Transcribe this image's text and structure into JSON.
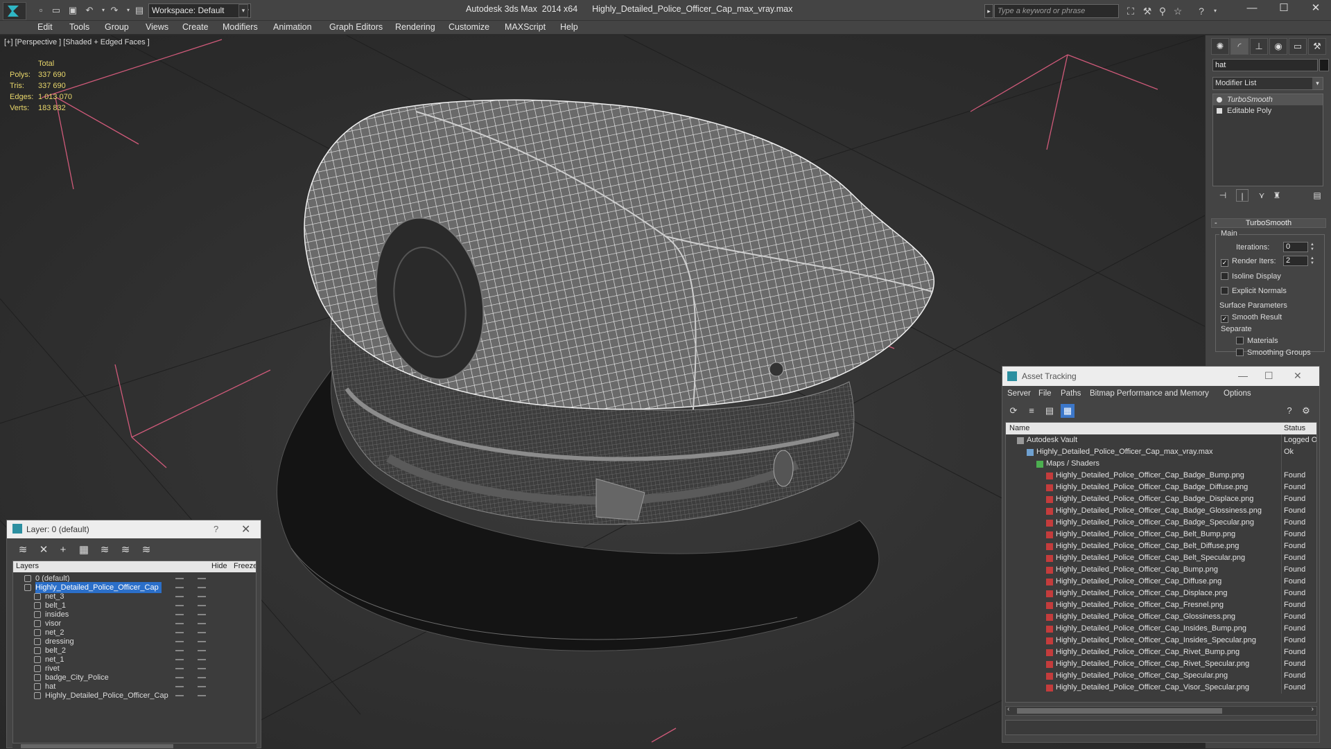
{
  "titlebar": {
    "workspace": "Workspace: Default",
    "app_title": "Autodesk 3ds Max  2014 x64",
    "file_title": "Highly_Detailed_Police_Officer_Cap_max_vray.max",
    "search_placeholder": "Type a keyword or phrase"
  },
  "menubar": [
    "Edit",
    "Tools",
    "Group",
    "Views",
    "Create",
    "Modifiers",
    "Animation",
    "Graph Editors",
    "Rendering",
    "Customize",
    "MAXScript",
    "Help"
  ],
  "viewport": {
    "label": "[+] [Perspective ] [Shaded + Edged Faces ]",
    "stats": {
      "header": "Total",
      "rows": [
        {
          "label": "Polys:",
          "value": "337 690"
        },
        {
          "label": "Tris:",
          "value": "337 690"
        },
        {
          "label": "Edges:",
          "value": "1 013 070"
        },
        {
          "label": "Verts:",
          "value": "183 832"
        }
      ]
    }
  },
  "command_panel": {
    "object_name": "hat",
    "modifier_list": "Modifier List",
    "stack": [
      "TurboSmooth",
      "Editable Poly"
    ],
    "rollout": "TurboSmooth",
    "main_group": "Main",
    "iterations_label": "Iterations:",
    "iterations_value": "0",
    "render_iters_label": "Render Iters:",
    "render_iters_value": "2",
    "isoline": "Isoline Display",
    "explicit_normals": "Explicit Normals",
    "surface_group": "Surface Parameters",
    "smooth_result": "Smooth Result",
    "separate": "Separate",
    "materials": "Materials",
    "smoothing_groups": "Smoothing Groups"
  },
  "layer_dialog": {
    "title": "Layer: 0 (default)",
    "help": "?",
    "columns": {
      "layers": "Layers",
      "hide": "Hide",
      "freeze": "Freeze"
    },
    "layers": [
      {
        "name": "0 (default)",
        "level": 0
      },
      {
        "name": "Highly_Detailed_Police_Officer_Cap",
        "level": 0,
        "selected": true
      },
      {
        "name": "net_3",
        "level": 1
      },
      {
        "name": "belt_1",
        "level": 1
      },
      {
        "name": "insides",
        "level": 1
      },
      {
        "name": "visor",
        "level": 1
      },
      {
        "name": "net_2",
        "level": 1
      },
      {
        "name": "dressing",
        "level": 1
      },
      {
        "name": "belt_2",
        "level": 1
      },
      {
        "name": "net_1",
        "level": 1
      },
      {
        "name": "rivet",
        "level": 1
      },
      {
        "name": "badge_City_Police",
        "level": 1
      },
      {
        "name": "hat",
        "level": 1
      },
      {
        "name": "Highly_Detailed_Police_Officer_Cap",
        "level": 1
      }
    ]
  },
  "asset_dialog": {
    "title": "Asset Tracking",
    "menu": [
      "Server",
      "File",
      "Paths",
      "Bitmap Performance and Memory",
      "Options"
    ],
    "columns": {
      "name": "Name",
      "status": "Status"
    },
    "rows": [
      {
        "name": "Autodesk Vault",
        "status": "Logged O",
        "level": 0
      },
      {
        "name": "Highly_Detailed_Police_Officer_Cap_max_vray.max",
        "status": "Ok",
        "level": 1
      },
      {
        "name": "Maps / Shaders",
        "status": "",
        "level": 2
      },
      {
        "name": "Highly_Detailed_Police_Officer_Cap_Badge_Bump.png",
        "status": "Found",
        "level": 3
      },
      {
        "name": "Highly_Detailed_Police_Officer_Cap_Badge_Diffuse.png",
        "status": "Found",
        "level": 3
      },
      {
        "name": "Highly_Detailed_Police_Officer_Cap_Badge_Displace.png",
        "status": "Found",
        "level": 3
      },
      {
        "name": "Highly_Detailed_Police_Officer_Cap_Badge_Glossiness.png",
        "status": "Found",
        "level": 3
      },
      {
        "name": "Highly_Detailed_Police_Officer_Cap_Badge_Specular.png",
        "status": "Found",
        "level": 3
      },
      {
        "name": "Highly_Detailed_Police_Officer_Cap_Belt_Bump.png",
        "status": "Found",
        "level": 3
      },
      {
        "name": "Highly_Detailed_Police_Officer_Cap_Belt_Diffuse.png",
        "status": "Found",
        "level": 3
      },
      {
        "name": "Highly_Detailed_Police_Officer_Cap_Belt_Specular.png",
        "status": "Found",
        "level": 3
      },
      {
        "name": "Highly_Detailed_Police_Officer_Cap_Bump.png",
        "status": "Found",
        "level": 3
      },
      {
        "name": "Highly_Detailed_Police_Officer_Cap_Diffuse.png",
        "status": "Found",
        "level": 3
      },
      {
        "name": "Highly_Detailed_Police_Officer_Cap_Displace.png",
        "status": "Found",
        "level": 3
      },
      {
        "name": "Highly_Detailed_Police_Officer_Cap_Fresnel.png",
        "status": "Found",
        "level": 3
      },
      {
        "name": "Highly_Detailed_Police_Officer_Cap_Glossiness.png",
        "status": "Found",
        "level": 3
      },
      {
        "name": "Highly_Detailed_Police_Officer_Cap_Insides_Bump.png",
        "status": "Found",
        "level": 3
      },
      {
        "name": "Highly_Detailed_Police_Officer_Cap_Insides_Specular.png",
        "status": "Found",
        "level": 3
      },
      {
        "name": "Highly_Detailed_Police_Officer_Cap_Rivet_Bump.png",
        "status": "Found",
        "level": 3
      },
      {
        "name": "Highly_Detailed_Police_Officer_Cap_Rivet_Specular.png",
        "status": "Found",
        "level": 3
      },
      {
        "name": "Highly_Detailed_Police_Officer_Cap_Specular.png",
        "status": "Found",
        "level": 3
      },
      {
        "name": "Highly_Detailed_Police_Officer_Cap_Visor_Specular.png",
        "status": "Found",
        "level": 3
      }
    ]
  },
  "colors": {
    "stats_text": "#e9d76b",
    "selection": "#2b6fc9",
    "grid_lines": "#d05a7a"
  }
}
